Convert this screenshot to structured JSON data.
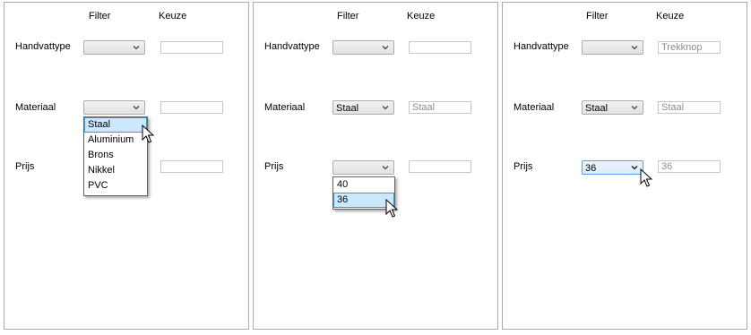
{
  "headers": {
    "filter": "Filter",
    "keuze": "Keuze"
  },
  "labels": {
    "handvattype": "Handvattype",
    "materiaal": "Materiaal",
    "prijs": "Prijs"
  },
  "icons": {
    "dropdown_arrow": "chevron-down-icon",
    "cursor": "mouse-pointer-icon"
  },
  "colors": {
    "selection_bg": "#cce8ff",
    "selection_border": "#26a0da",
    "focus_border": "#569de5",
    "placeholder_text": "#8d8d8d"
  },
  "panels": [
    {
      "handvattype": {
        "filter": "",
        "keuze": ""
      },
      "materiaal": {
        "filter": "",
        "keuze": ""
      },
      "prijs": {
        "filter": "",
        "keuze": ""
      },
      "dropdown": {
        "options": [
          "Staal",
          "Aluminium",
          "Brons",
          "Nikkel",
          "PVC"
        ],
        "selected": "Staal"
      }
    },
    {
      "handvattype": {
        "filter": "",
        "keuze": ""
      },
      "materiaal": {
        "filter": "Staal",
        "keuze": "Staal"
      },
      "prijs": {
        "filter": "",
        "keuze": ""
      },
      "dropdown": {
        "options": [
          "40",
          "36"
        ],
        "selected": "36"
      }
    },
    {
      "handvattype": {
        "filter": "",
        "keuze": "Trekknop"
      },
      "materiaal": {
        "filter": "Staal",
        "keuze": "Staal"
      },
      "prijs": {
        "filter": "36",
        "keuze": "36"
      }
    }
  ]
}
